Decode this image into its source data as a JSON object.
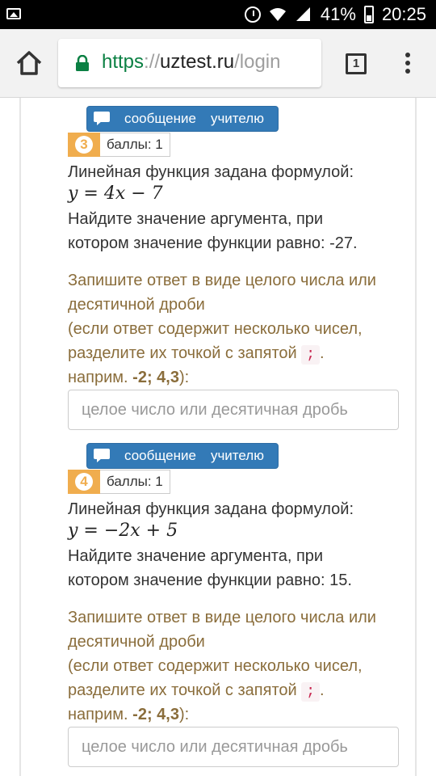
{
  "status_bar": {
    "battery": "41%",
    "time": "20:25"
  },
  "browser": {
    "url_scheme": "https",
    "url_sep": "://",
    "url_host": "uztest.ru",
    "url_path": "/login",
    "tab_count": "1"
  },
  "message_button": {
    "word1": "сообщение",
    "word2": "учителю"
  },
  "questions": [
    {
      "number": "3",
      "points_label": "баллы: 1",
      "prompt": "Линейная функция задана формулой:",
      "formula": "y = 4x − 7",
      "task_line1": "Найдите значение аргумента, при",
      "task_line2": "котором значение функции равно: -27.",
      "hint_line1": "Запишите ответ в виде целого числа или",
      "hint_line2": "десятичной дроби",
      "hint_line3": "(если ответ содержит несколько чисел,",
      "hint_line4a": "разделите их точкой с запятой",
      "hint_sep": ";",
      "hint_line4b": ".",
      "hint_line5a": "наприм.",
      "hint_example": "-2; 4,3",
      "hint_line5b": "):",
      "answer_placeholder": "целое число или десятичная дробь",
      "answer_value": ""
    },
    {
      "number": "4",
      "points_label": "баллы: 1",
      "prompt": "Линейная функция задана формулой:",
      "formula": "y = −2x + 5",
      "task_line1": "Найдите значение аргумента, при",
      "task_line2": "котором значение функции равно: 15.",
      "hint_line1": "Запишите ответ в виде целого числа или",
      "hint_line2": "десятичной дроби",
      "hint_line3": "(если ответ содержит несколько чисел,",
      "hint_line4a": "разделите их точкой с запятой",
      "hint_sep": ";",
      "hint_line4b": ".",
      "hint_line5a": "наприм.",
      "hint_example": "-2; 4,3",
      "hint_line5b": "):",
      "answer_placeholder": "целое число или десятичная дробь",
      "answer_value": ""
    }
  ]
}
